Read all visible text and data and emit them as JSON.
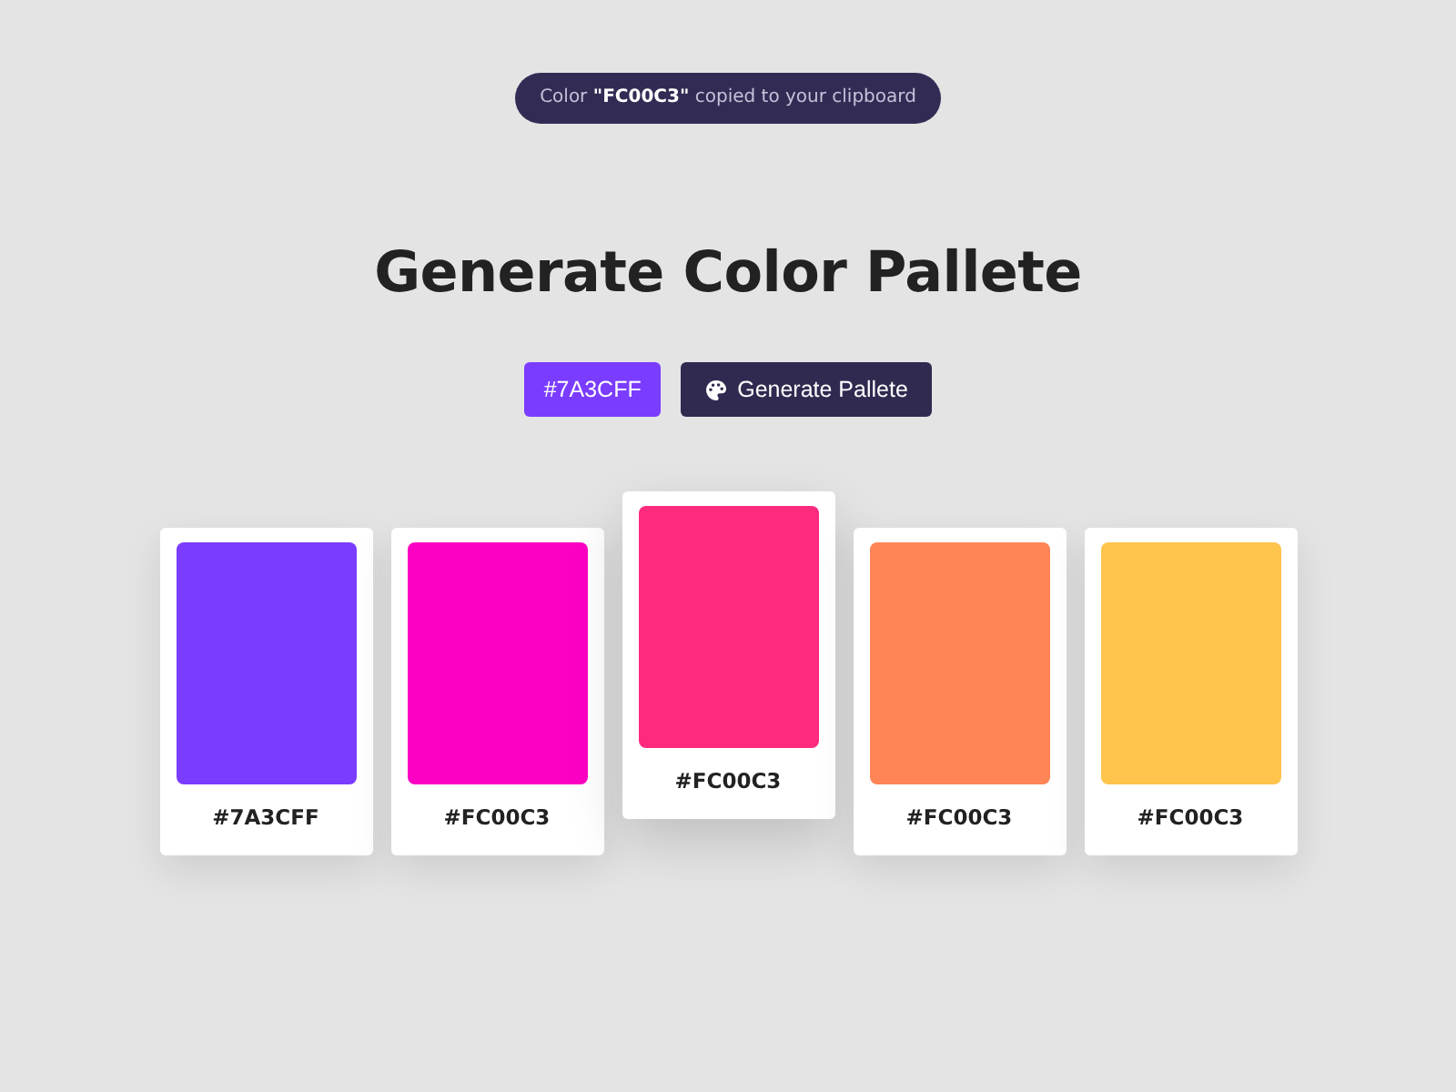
{
  "toast": {
    "text": "Color **\"FC00C3\"** copied to your clipboard"
  },
  "title": "Generate Color Pallete",
  "controls": {
    "color_input": {
      "value": "#7A3CFF",
      "color": "#7a3cff"
    },
    "generate_button": {
      "label": "Generate Pallete"
    }
  },
  "palette": [
    {
      "hex": "#7A3CFF",
      "color": "#7a3cff",
      "selected": false
    },
    {
      "hex": "#FC00C3",
      "color": "#fc00c3",
      "selected": false
    },
    {
      "hex": "#FC00C3",
      "color": "#fe2a7e",
      "selected": true
    },
    {
      "hex": "#FC00C3",
      "color": "#ff8456",
      "selected": false
    },
    {
      "hex": "#FC00C3",
      "color": "#ffc44b",
      "selected": false
    }
  ]
}
